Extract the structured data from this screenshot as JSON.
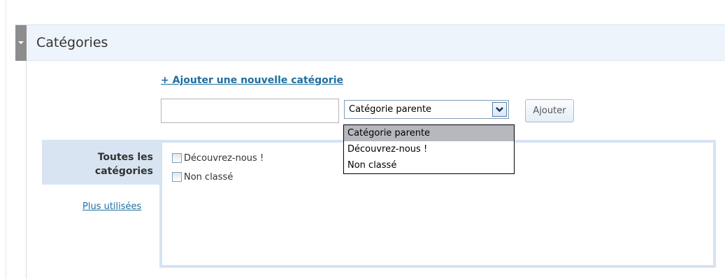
{
  "panel": {
    "title": "Catégories"
  },
  "add_new": {
    "link_label": "+ Ajouter une nouvelle catégorie",
    "input_value": "",
    "parent_select": {
      "selected": "Catégorie parente",
      "options": [
        "Catégorie parente",
        "Découvrez-nous !",
        "Non classé"
      ]
    },
    "button_label": "Ajouter"
  },
  "tabs": {
    "all_label": "Toutes les catégories",
    "popular_label": "Plus utilisées"
  },
  "categories": [
    {
      "label": "Découvrez-nous !",
      "checked": false
    },
    {
      "label": "Non classé",
      "checked": false
    }
  ],
  "colors": {
    "link": "#1f6fa0",
    "header_background": "#eef4fb",
    "tab_background": "#d8e4f1",
    "selected_option": "#b7b7c0"
  },
  "icons": {
    "panel_toggle": "caret-down-icon",
    "select_arrow": "chevron-down-icon"
  }
}
